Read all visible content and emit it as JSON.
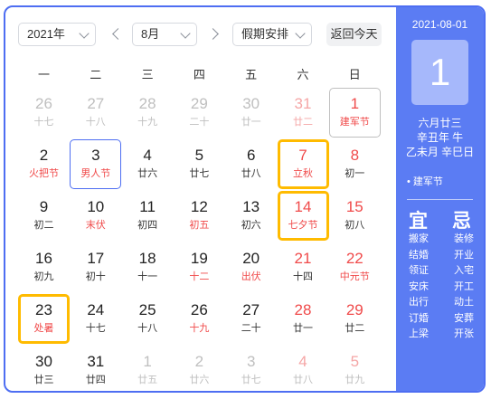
{
  "toolbar": {
    "year": "2021年",
    "month": "8月",
    "holiday": "假期安排",
    "today_button": "返回今天"
  },
  "weekdays": [
    "一",
    "二",
    "三",
    "四",
    "五",
    "六",
    "日"
  ],
  "rows": [
    [
      {
        "num": "26",
        "sub": "十七",
        "other": true
      },
      {
        "num": "27",
        "sub": "十八",
        "other": true
      },
      {
        "num": "28",
        "sub": "十九",
        "other": true
      },
      {
        "num": "29",
        "sub": "二十",
        "other": true
      },
      {
        "num": "30",
        "sub": "廿一",
        "other": true
      },
      {
        "num": "31",
        "sub": "廿二",
        "other": true,
        "red": true,
        "subRed": true
      },
      {
        "num": "1",
        "sub": "建军节",
        "red": true,
        "subRed": true,
        "selected": true
      }
    ],
    [
      {
        "num": "2",
        "sub": "火把节",
        "subRed": true
      },
      {
        "num": "3",
        "sub": "男人节",
        "subRed": true,
        "today": true
      },
      {
        "num": "4",
        "sub": "廿六"
      },
      {
        "num": "5",
        "sub": "廿七"
      },
      {
        "num": "6",
        "sub": "廿八"
      },
      {
        "num": "7",
        "sub": "立秋",
        "red": true,
        "subRed": true,
        "highlight": true
      },
      {
        "num": "8",
        "sub": "初一",
        "red": true
      }
    ],
    [
      {
        "num": "9",
        "sub": "初二"
      },
      {
        "num": "10",
        "sub": "末伏",
        "subRed": true
      },
      {
        "num": "11",
        "sub": "初四"
      },
      {
        "num": "12",
        "sub": "初五",
        "subRed": true
      },
      {
        "num": "13",
        "sub": "初六"
      },
      {
        "num": "14",
        "sub": "七夕节",
        "red": true,
        "subRed": true,
        "highlight": true
      },
      {
        "num": "15",
        "sub": "初八",
        "red": true
      }
    ],
    [
      {
        "num": "16",
        "sub": "初九"
      },
      {
        "num": "17",
        "sub": "初十"
      },
      {
        "num": "18",
        "sub": "十一"
      },
      {
        "num": "19",
        "sub": "十二",
        "subRed": true
      },
      {
        "num": "20",
        "sub": "出伏",
        "subRed": true
      },
      {
        "num": "21",
        "sub": "十四",
        "red": true
      },
      {
        "num": "22",
        "sub": "中元节",
        "red": true,
        "subRed": true
      }
    ],
    [
      {
        "num": "23",
        "sub": "处暑",
        "subRed": true,
        "highlight": true
      },
      {
        "num": "24",
        "sub": "十七"
      },
      {
        "num": "25",
        "sub": "十八"
      },
      {
        "num": "26",
        "sub": "十九",
        "subRed": true
      },
      {
        "num": "27",
        "sub": "二十"
      },
      {
        "num": "28",
        "sub": "廿一",
        "red": true
      },
      {
        "num": "29",
        "sub": "廿二",
        "red": true
      }
    ],
    [
      {
        "num": "30",
        "sub": "廿三"
      },
      {
        "num": "31",
        "sub": "廿四"
      },
      {
        "num": "1",
        "sub": "廿五",
        "other": true
      },
      {
        "num": "2",
        "sub": "廿六",
        "other": true
      },
      {
        "num": "3",
        "sub": "廿七",
        "other": true
      },
      {
        "num": "4",
        "sub": "廿八",
        "other": true,
        "red": true
      },
      {
        "num": "5",
        "sub": "廿九",
        "other": true,
        "red": true
      }
    ]
  ],
  "side": {
    "date": "2021-08-01",
    "day": "1",
    "lunar_lines": [
      "六月廿三",
      "辛丑年 牛",
      "乙未月 辛巳日"
    ],
    "festival": "• 建军节",
    "yi_label": "宜",
    "ji_label": "忌",
    "yi": [
      "搬家",
      "结婚",
      "领证",
      "安床",
      "出行",
      "订婚",
      "上梁"
    ],
    "ji": [
      "装修",
      "开业",
      "入宅",
      "开工",
      "动土",
      "安葬",
      "开张"
    ]
  },
  "colors": {
    "accent": "#4e6ef2",
    "panel": "#5b7cf3",
    "highlight": "#ffbb00",
    "festival_red": "#f04a4a"
  }
}
